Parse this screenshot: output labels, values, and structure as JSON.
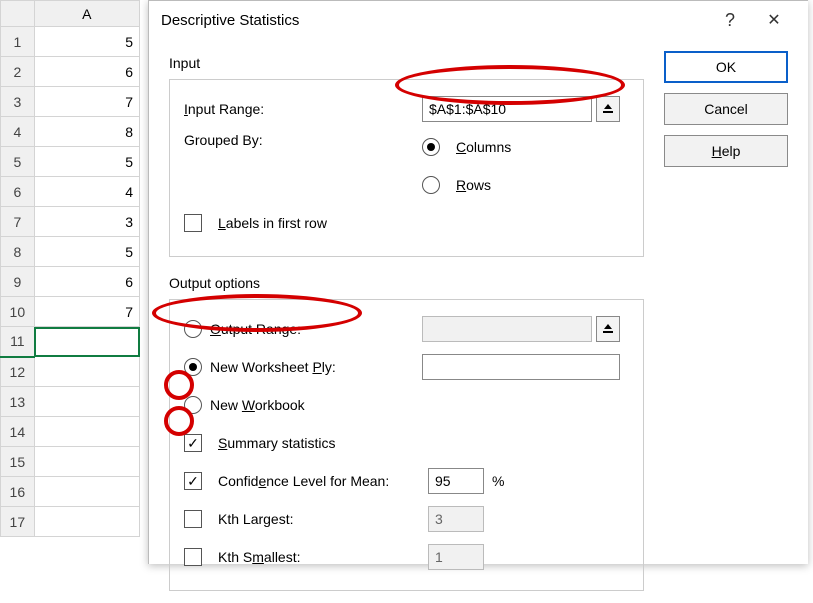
{
  "sheet": {
    "col_header": "A",
    "rows": [
      "5",
      "6",
      "7",
      "8",
      "5",
      "4",
      "3",
      "5",
      "6",
      "7",
      "",
      "",
      "",
      "",
      "",
      "",
      ""
    ]
  },
  "dialog": {
    "title": "Descriptive Statistics",
    "buttons": {
      "ok": "OK",
      "cancel": "Cancel",
      "help": "Help"
    },
    "input": {
      "group_label": "Input",
      "range_label_pre": "I",
      "range_label_post": "nput Range:",
      "range_value": "$A$1:$A$10",
      "grouped_by_label": "Grouped By:",
      "columns_pre": "C",
      "columns_post": "olumns",
      "rows_pre": "R",
      "rows_post": "ows",
      "labels_pre": "L",
      "labels_post": "abels in first row"
    },
    "output": {
      "group_label": "Output options",
      "range_pre": "O",
      "range_post": "utput Range:",
      "ply_pre": "New Worksheet ",
      "ply_u": "P",
      "ply_post": "ly:",
      "wb_pre": "New ",
      "wb_u": "W",
      "wb_post": "orkbook",
      "summary_pre": "S",
      "summary_post": "ummary statistics",
      "conf_pre": "Confid",
      "conf_u": "e",
      "conf_post": "nce Level for Mean:",
      "conf_value": "95",
      "percent": "%",
      "kth_largest": "Kth Largest:",
      "kth_largest_val": "3",
      "kth_smallest_pre": "Kth S",
      "kth_smallest_u": "m",
      "kth_smallest_post": "allest:",
      "kth_smallest_val": "1"
    }
  }
}
